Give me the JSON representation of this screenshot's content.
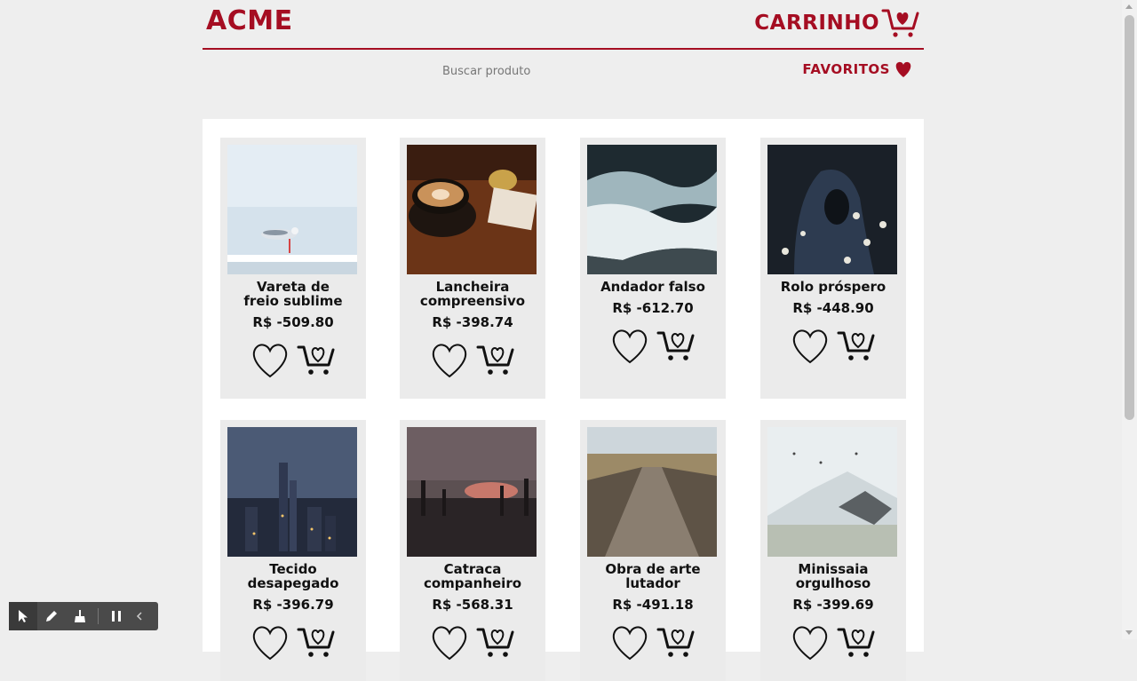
{
  "header": {
    "logo": "ACME",
    "cart_label": "CARRINHO"
  },
  "subbar": {
    "search_placeholder": "Buscar produto",
    "favorites_label": "FAVORITOS"
  },
  "colors": {
    "brand": "#a50d22",
    "card_bg": "#ebebeb",
    "panel_bg": "#ffffff",
    "page_bg": "#eeeeee"
  },
  "products": [
    {
      "name": "Vareta de freio sublime",
      "price": "R$ -509.80",
      "image": "seagull-on-railing"
    },
    {
      "name": "Lancheira compreensivo",
      "price": "R$ -398.74",
      "image": "coffee-cup-and-bell"
    },
    {
      "name": "Andador falso",
      "price": "R$ -612.70",
      "image": "ocean-waves"
    },
    {
      "name": "Rolo próspero",
      "price": "R$ -448.90",
      "image": "hooded-person-flowers"
    },
    {
      "name": "Tecido desapegado",
      "price": "R$ -396.79",
      "image": "city-skyline-dusk"
    },
    {
      "name": "Catraca companheiro",
      "price": "R$ -568.31",
      "image": "bridge-statues-sunset"
    },
    {
      "name": "Obra de arte lutador",
      "price": "R$ -491.18",
      "image": "wooden-boardwalk"
    },
    {
      "name": "Minissaia orgulhoso",
      "price": "R$ -399.69",
      "image": "snowy-mountain"
    }
  ],
  "toolbar": {
    "icons": [
      "cursor-icon",
      "pen-icon",
      "broom-icon",
      "pause-icon",
      "chevron-left-icon"
    ]
  }
}
